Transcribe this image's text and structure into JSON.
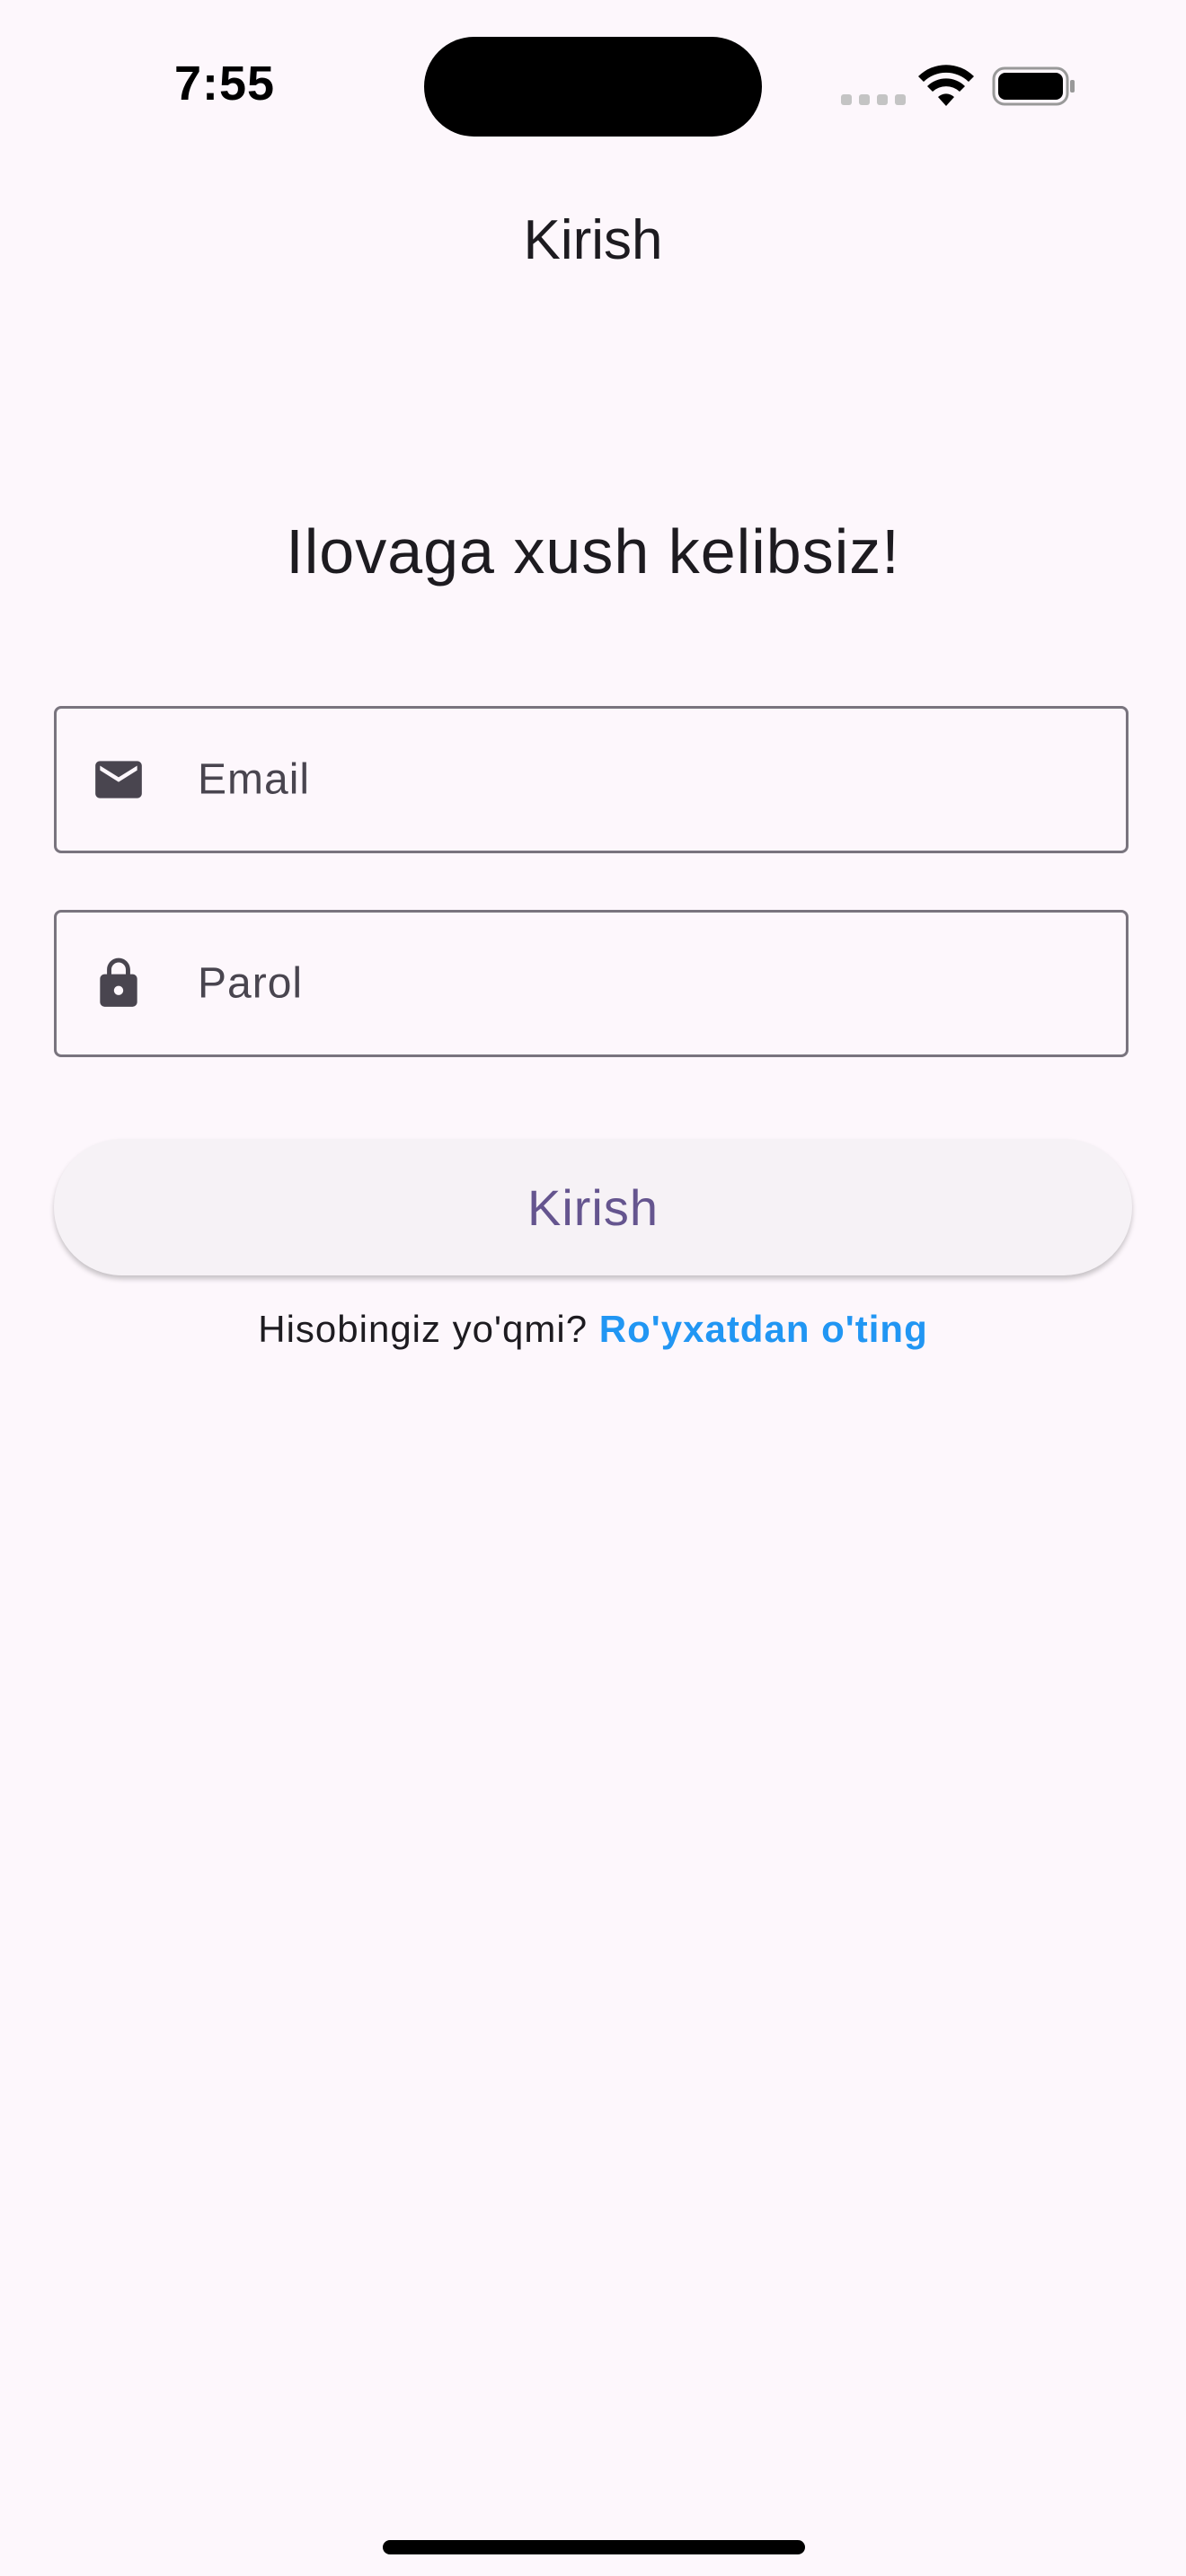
{
  "status_bar": {
    "time": "7:55"
  },
  "app_bar": {
    "title": "Kirish"
  },
  "welcome_text": "Ilovaga xush kelibsiz!",
  "form": {
    "email": {
      "placeholder": "Email",
      "icon": "mail-icon"
    },
    "password": {
      "placeholder": "Parol",
      "icon": "lock-icon"
    },
    "submit_label": "Kirish"
  },
  "register": {
    "question": "Hisobingiz yo'qmi?",
    "link_label": "Ro'yxatdan o'ting"
  },
  "colors": {
    "background": "#fdf7fc",
    "primary": "#65558f",
    "link": "#2196f3",
    "outline": "#79747e"
  }
}
